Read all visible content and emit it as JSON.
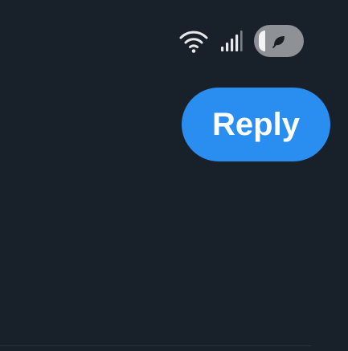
{
  "status_bar": {
    "wifi_icon": "wifi-icon",
    "signal_icon": "cellular-signal-icon",
    "battery_icon": "low-power-leaf-icon",
    "icon_color": "#e6e8ea",
    "pill_color": "#8e9296"
  },
  "reply_button": {
    "label": "Reply",
    "color": "#2a8df0",
    "text_color": "#ffffff"
  },
  "colors": {
    "background": "#18202a"
  }
}
